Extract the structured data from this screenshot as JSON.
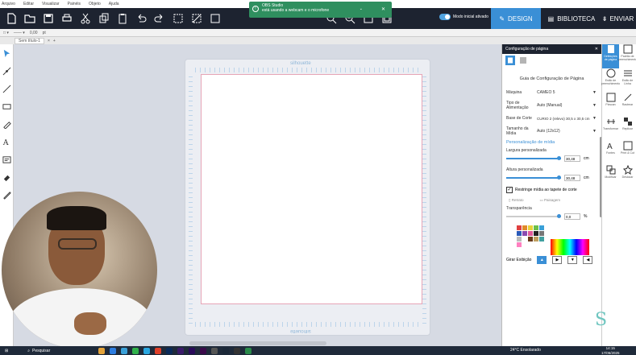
{
  "menu": [
    "Arquivo",
    "Editar",
    "Visualizar",
    "Painéis",
    "Objeto",
    "Ajuda"
  ],
  "toolbar": {
    "toggle_label": "Modo inicial ativado",
    "design_label": "DESIGN",
    "library_label": "BIBLIOTECA",
    "send_label": "ENVIAR",
    "accent": "#3a8fd6"
  },
  "notification": {
    "title": "OBS Studio",
    "message": "está usando a webcam e o microfone"
  },
  "subbar": {
    "line_value": "0,00",
    "unit": "pt"
  },
  "document_tab": "Sem título-1",
  "mat": {
    "logo": "silhouette"
  },
  "panel": {
    "header": "Configuração de página",
    "title": "Guia de Configuração de Página",
    "rows": [
      {
        "label": "Máquina",
        "value": "CAMEO 5"
      },
      {
        "label": "Tipo de Alimentação",
        "value": "Auto (Manual)"
      },
      {
        "label": "Base de Corte",
        "value": "CURIO 2 (relevo) 30,5 x 30,5 cm"
      },
      {
        "label": "Tamanho da Mídia",
        "value": "Auto (12x12)"
      }
    ],
    "custom_section": "Personalização de mídia",
    "width_label": "Largura personalizada",
    "width_value": "30,48",
    "height_label": "Altura personalizada",
    "height_value": "30,48",
    "unit": "cm",
    "restrict_label": "Restringe mídia ao tapete de corte",
    "portrait": "Retrato",
    "landscape": "Paisagem",
    "transparency_label": "Transparência",
    "transparency_value": "0,0",
    "transparency_unit": "%",
    "view_label": "Girar Exibição"
  },
  "sidepanel": [
    "Definições de página",
    "Padrão de preenchimento",
    "Estilo de preenchimento",
    "Estilo de Linha",
    "Pixscan",
    "Rastrear",
    "Transformar",
    "Replicar",
    "Fontes",
    "Print & Cut",
    "Modificar",
    "Deslocar"
  ],
  "taskbar": {
    "search": "Pesquisar",
    "weather": "24°C Ensolarado",
    "time": "14:15",
    "date": "17/06/2025"
  },
  "swatch_colors": [
    "#e04040",
    "#e08a2a",
    "#e8d23a",
    "#6cbf4a",
    "#3aa0d8",
    "#2a5ab8",
    "#8a4ab0",
    "#e05a9a",
    "#222222",
    "#777777",
    "#bbbbbb",
    "#ffffff",
    "#6a3a1a",
    "#c0a060",
    "#40a0a0",
    "#ff80c0"
  ]
}
